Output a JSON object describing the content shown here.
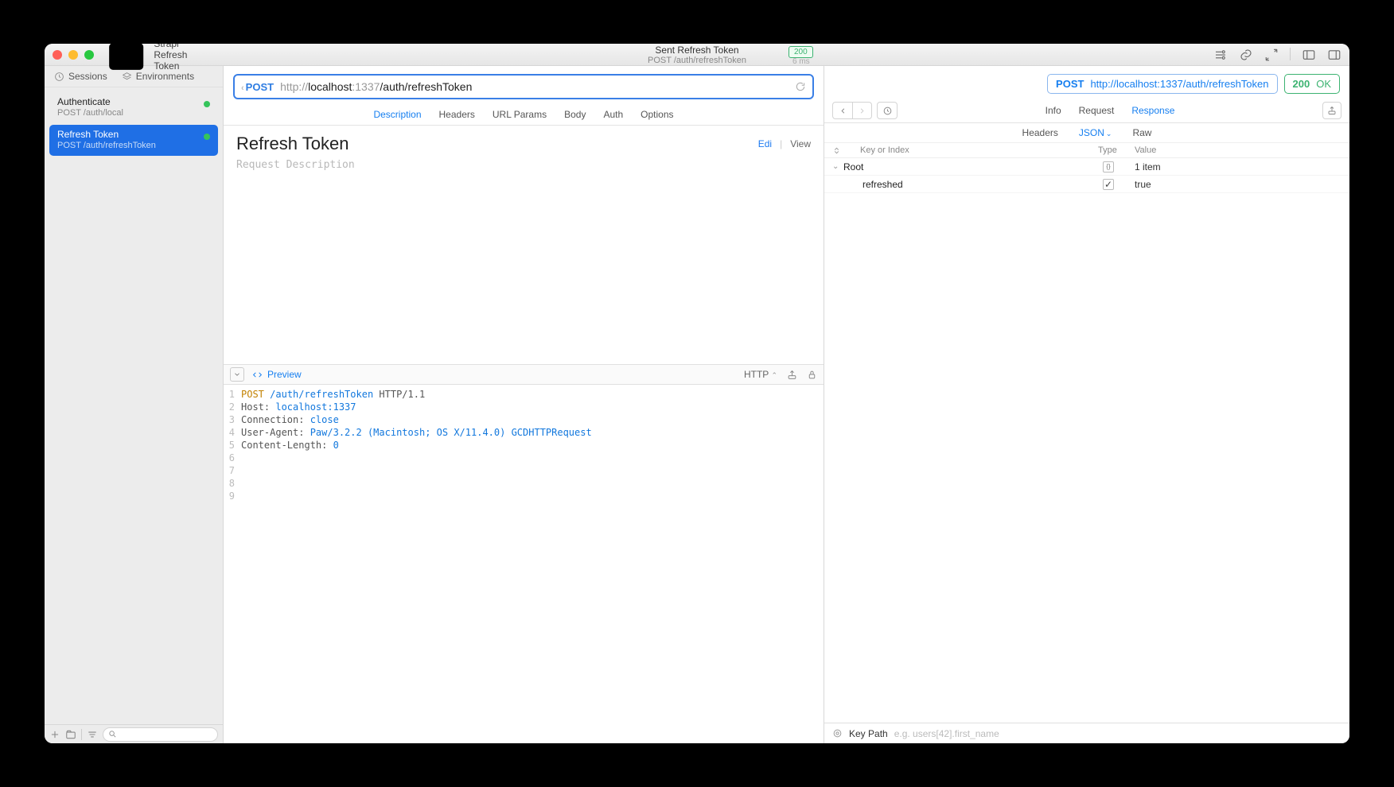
{
  "window": {
    "title": "Strapi Refresh Token",
    "header_title": "Sent Refresh Token",
    "header_subtitle": "POST /auth/refreshToken",
    "status_code": "200",
    "status_time": "6 ms"
  },
  "sidebar": {
    "tab_sessions": "Sessions",
    "tab_environments": "Environments",
    "items": [
      {
        "name": "Authenticate",
        "path": "POST /auth/local"
      },
      {
        "name": "Refresh Token",
        "path": "POST /auth/refreshToken"
      }
    ]
  },
  "request": {
    "method": "POST",
    "url_dim1": "http://",
    "url_host": "localhost",
    "url_dim2": ":1337",
    "url_path": "/auth/refreshToken",
    "tabs": {
      "description": "Description",
      "headers": "Headers",
      "url_params": "URL Params",
      "body": "Body",
      "auth": "Auth",
      "options": "Options"
    },
    "title": "Refresh Token",
    "placeholder": "Request Description",
    "actions": {
      "edit": "Edi",
      "view": "View"
    }
  },
  "code": {
    "preview_label": "Preview",
    "lang": "HTTP",
    "lines": [
      {
        "n": "1",
        "kw": "POST",
        "pth": "/auth/refreshToken",
        "tail": " HTTP/1.1"
      },
      {
        "n": "2",
        "k": "Host: ",
        "v": "localhost:1337"
      },
      {
        "n": "3",
        "k": "Connection: ",
        "v": "close"
      },
      {
        "n": "4",
        "k": "User-Agent: ",
        "v": "Paw/3.2.2 (Macintosh; OS X/11.4.0) GCDHTTPRequest"
      },
      {
        "n": "5",
        "k": "Content-Length: ",
        "v": "0"
      },
      {
        "n": "6",
        "k": "",
        "v": ""
      },
      {
        "n": "7",
        "k": "",
        "v": ""
      },
      {
        "n": "8",
        "k": "",
        "v": ""
      },
      {
        "n": "9",
        "k": "",
        "v": ""
      }
    ]
  },
  "response": {
    "method": "POST",
    "url": "http://localhost:1337/auth/refreshToken",
    "status_code": "200",
    "status_text": "OK",
    "tabs": {
      "info": "Info",
      "request": "Request",
      "response": "Response"
    },
    "subtabs": {
      "headers": "Headers",
      "json": "JSON",
      "raw": "Raw"
    },
    "columns": {
      "key": "Key or Index",
      "type": "Type",
      "value": "Value"
    },
    "root_label": "Root",
    "root_value": "1 item",
    "rows": [
      {
        "key": "refreshed",
        "value": "true"
      }
    ],
    "keypath_label": "Key Path",
    "keypath_placeholder": "e.g. users[42].first_name"
  }
}
